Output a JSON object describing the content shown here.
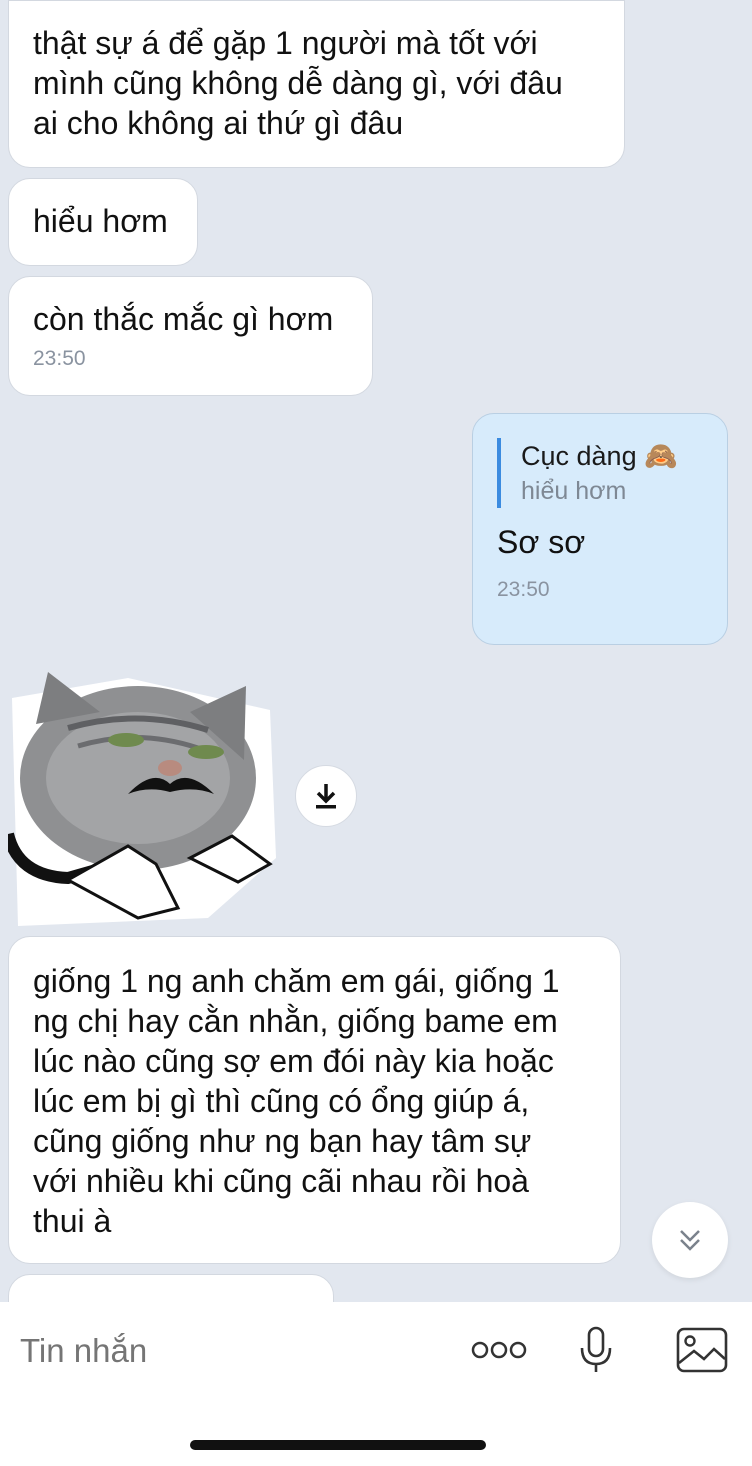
{
  "messages": [
    {
      "text": "thật sự á để gặp 1 người mà tốt với\nmình cũng không dễ dàng gì, với đâu\nai cho không ai thứ gì đâu"
    },
    {
      "text": "hiểu hơm"
    },
    {
      "text": "còn thắc mắc gì hơm",
      "time": "23:50"
    },
    {
      "quote_name": "Cục dàng 🙈",
      "quote_text": "hiểu hơm",
      "text": "Sơ sơ",
      "time": "23:50"
    },
    {
      "text": "giống 1 ng anh chăm em gái, giống 1\nng chị hay cằn nhằn, giống bame em\nlúc nào cũng sợ em đói này kia hoặc\nlúc em bị gì thì cũng có ổng giúp á,\ncũng giống như ng bạn hay tâm sự\nvới nhiều khi cũng cãi nhau rồi hoà\nthui à"
    },
    {
      "text": ""
    }
  ],
  "composer": {
    "placeholder": "Tin nhắn"
  },
  "icons": {
    "download": "download-icon",
    "scroll": "double-chevron-down-icon",
    "more": "more-dots-icon",
    "mic": "microphone-icon",
    "gallery": "image-icon"
  }
}
